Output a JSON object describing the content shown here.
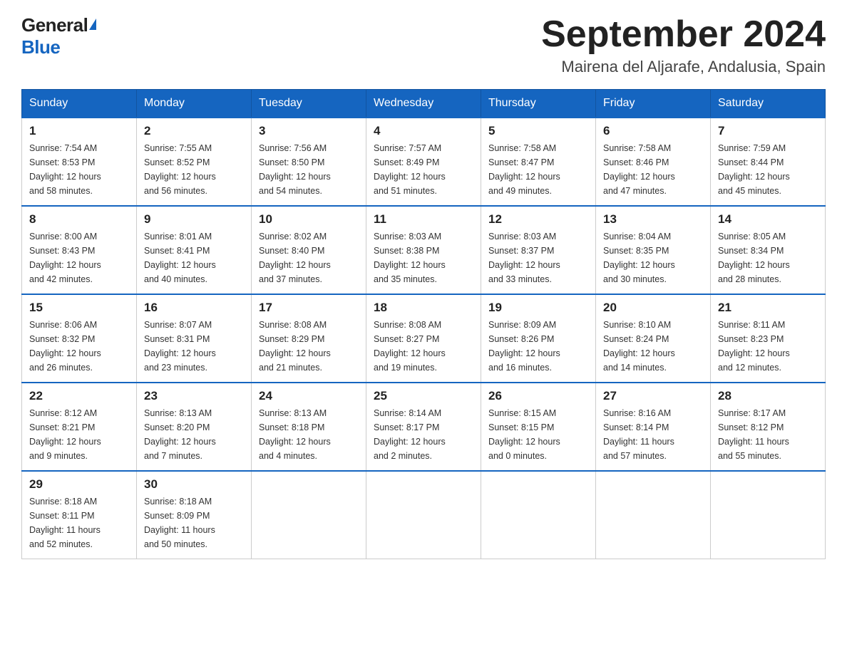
{
  "logo": {
    "general": "General",
    "blue": "Blue"
  },
  "title": "September 2024",
  "subtitle": "Mairena del Aljarafe, Andalusia, Spain",
  "weekdays": [
    "Sunday",
    "Monday",
    "Tuesday",
    "Wednesday",
    "Thursday",
    "Friday",
    "Saturday"
  ],
  "weeks": [
    [
      {
        "day": "1",
        "sunrise": "7:54 AM",
        "sunset": "8:53 PM",
        "daylight": "12 hours and 58 minutes."
      },
      {
        "day": "2",
        "sunrise": "7:55 AM",
        "sunset": "8:52 PM",
        "daylight": "12 hours and 56 minutes."
      },
      {
        "day": "3",
        "sunrise": "7:56 AM",
        "sunset": "8:50 PM",
        "daylight": "12 hours and 54 minutes."
      },
      {
        "day": "4",
        "sunrise": "7:57 AM",
        "sunset": "8:49 PM",
        "daylight": "12 hours and 51 minutes."
      },
      {
        "day": "5",
        "sunrise": "7:58 AM",
        "sunset": "8:47 PM",
        "daylight": "12 hours and 49 minutes."
      },
      {
        "day": "6",
        "sunrise": "7:58 AM",
        "sunset": "8:46 PM",
        "daylight": "12 hours and 47 minutes."
      },
      {
        "day": "7",
        "sunrise": "7:59 AM",
        "sunset": "8:44 PM",
        "daylight": "12 hours and 45 minutes."
      }
    ],
    [
      {
        "day": "8",
        "sunrise": "8:00 AM",
        "sunset": "8:43 PM",
        "daylight": "12 hours and 42 minutes."
      },
      {
        "day": "9",
        "sunrise": "8:01 AM",
        "sunset": "8:41 PM",
        "daylight": "12 hours and 40 minutes."
      },
      {
        "day": "10",
        "sunrise": "8:02 AM",
        "sunset": "8:40 PM",
        "daylight": "12 hours and 37 minutes."
      },
      {
        "day": "11",
        "sunrise": "8:03 AM",
        "sunset": "8:38 PM",
        "daylight": "12 hours and 35 minutes."
      },
      {
        "day": "12",
        "sunrise": "8:03 AM",
        "sunset": "8:37 PM",
        "daylight": "12 hours and 33 minutes."
      },
      {
        "day": "13",
        "sunrise": "8:04 AM",
        "sunset": "8:35 PM",
        "daylight": "12 hours and 30 minutes."
      },
      {
        "day": "14",
        "sunrise": "8:05 AM",
        "sunset": "8:34 PM",
        "daylight": "12 hours and 28 minutes."
      }
    ],
    [
      {
        "day": "15",
        "sunrise": "8:06 AM",
        "sunset": "8:32 PM",
        "daylight": "12 hours and 26 minutes."
      },
      {
        "day": "16",
        "sunrise": "8:07 AM",
        "sunset": "8:31 PM",
        "daylight": "12 hours and 23 minutes."
      },
      {
        "day": "17",
        "sunrise": "8:08 AM",
        "sunset": "8:29 PM",
        "daylight": "12 hours and 21 minutes."
      },
      {
        "day": "18",
        "sunrise": "8:08 AM",
        "sunset": "8:27 PM",
        "daylight": "12 hours and 19 minutes."
      },
      {
        "day": "19",
        "sunrise": "8:09 AM",
        "sunset": "8:26 PM",
        "daylight": "12 hours and 16 minutes."
      },
      {
        "day": "20",
        "sunrise": "8:10 AM",
        "sunset": "8:24 PM",
        "daylight": "12 hours and 14 minutes."
      },
      {
        "day": "21",
        "sunrise": "8:11 AM",
        "sunset": "8:23 PM",
        "daylight": "12 hours and 12 minutes."
      }
    ],
    [
      {
        "day": "22",
        "sunrise": "8:12 AM",
        "sunset": "8:21 PM",
        "daylight": "12 hours and 9 minutes."
      },
      {
        "day": "23",
        "sunrise": "8:13 AM",
        "sunset": "8:20 PM",
        "daylight": "12 hours and 7 minutes."
      },
      {
        "day": "24",
        "sunrise": "8:13 AM",
        "sunset": "8:18 PM",
        "daylight": "12 hours and 4 minutes."
      },
      {
        "day": "25",
        "sunrise": "8:14 AM",
        "sunset": "8:17 PM",
        "daylight": "12 hours and 2 minutes."
      },
      {
        "day": "26",
        "sunrise": "8:15 AM",
        "sunset": "8:15 PM",
        "daylight": "12 hours and 0 minutes."
      },
      {
        "day": "27",
        "sunrise": "8:16 AM",
        "sunset": "8:14 PM",
        "daylight": "11 hours and 57 minutes."
      },
      {
        "day": "28",
        "sunrise": "8:17 AM",
        "sunset": "8:12 PM",
        "daylight": "11 hours and 55 minutes."
      }
    ],
    [
      {
        "day": "29",
        "sunrise": "8:18 AM",
        "sunset": "8:11 PM",
        "daylight": "11 hours and 52 minutes."
      },
      {
        "day": "30",
        "sunrise": "8:18 AM",
        "sunset": "8:09 PM",
        "daylight": "11 hours and 50 minutes."
      },
      null,
      null,
      null,
      null,
      null
    ]
  ],
  "labels": {
    "sunrise": "Sunrise:",
    "sunset": "Sunset:",
    "daylight": "Daylight:"
  }
}
